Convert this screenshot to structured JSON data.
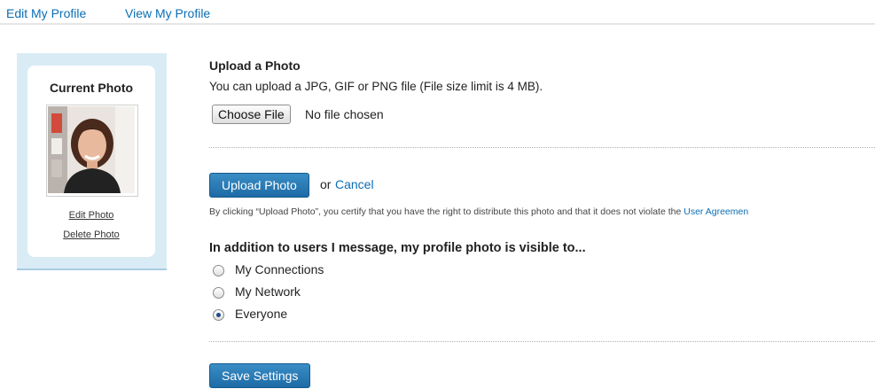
{
  "nav": {
    "edit_profile": "Edit My Profile",
    "view_profile": "View My Profile"
  },
  "current_photo": {
    "title": "Current Photo",
    "edit_link": "Edit Photo",
    "delete_link": "Delete Photo"
  },
  "upload": {
    "heading": "Upload a Photo",
    "description": "You can upload a JPG, GIF or PNG file (File size limit is 4 MB).",
    "choose_file_label": "Choose File",
    "file_status": "No file chosen",
    "upload_button": "Upload Photo",
    "or_text": "or",
    "cancel_link": "Cancel",
    "disclaimer": "By clicking “Upload Photo”, you certify that you have the right to distribute this photo and that it does not violate the",
    "agreement_link": "User Agreemen"
  },
  "visibility": {
    "heading": "In addition to users I message, my profile photo is visible to...",
    "options": [
      {
        "label": "My Connections",
        "selected": false
      },
      {
        "label": "My Network",
        "selected": false
      },
      {
        "label": "Everyone",
        "selected": true
      }
    ]
  },
  "save_button": "Save Settings",
  "colors": {
    "link": "#0b6eb4",
    "button_blue": "#1d6ba6",
    "panel_bg": "#d9ecf6"
  }
}
